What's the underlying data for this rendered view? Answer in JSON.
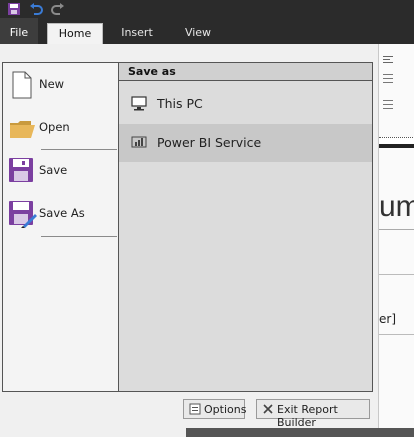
{
  "ribbon": {
    "tabs": [
      {
        "label": "File"
      },
      {
        "label": "Home"
      },
      {
        "label": "Insert"
      },
      {
        "label": "View"
      }
    ]
  },
  "backstage": {
    "nav": [
      {
        "label": "New",
        "icon": "new-document-icon"
      },
      {
        "label": "Open",
        "icon": "folder-open-icon"
      },
      {
        "label": "Save",
        "icon": "save-floppy-icon"
      },
      {
        "label": "Save As",
        "icon": "save-as-floppy-icon"
      }
    ],
    "pane_title": "Save as",
    "options": [
      {
        "label": "This PC",
        "icon": "computer-icon"
      },
      {
        "label": "Power BI Service",
        "icon": "power-bi-icon",
        "selected": true
      }
    ]
  },
  "footer": {
    "options_label": "Options",
    "exit_label": "Exit Report Builder"
  },
  "background_doc": {
    "heading_fragment": "um",
    "text_fragment": "er]"
  },
  "colors": {
    "titlebar": "#2b2b2b",
    "save_purple": "#7b3fa0",
    "folder_yellow": "#e8b75a",
    "undo_blue": "#3a7bd5",
    "selected_option": "#c8c8c8"
  }
}
